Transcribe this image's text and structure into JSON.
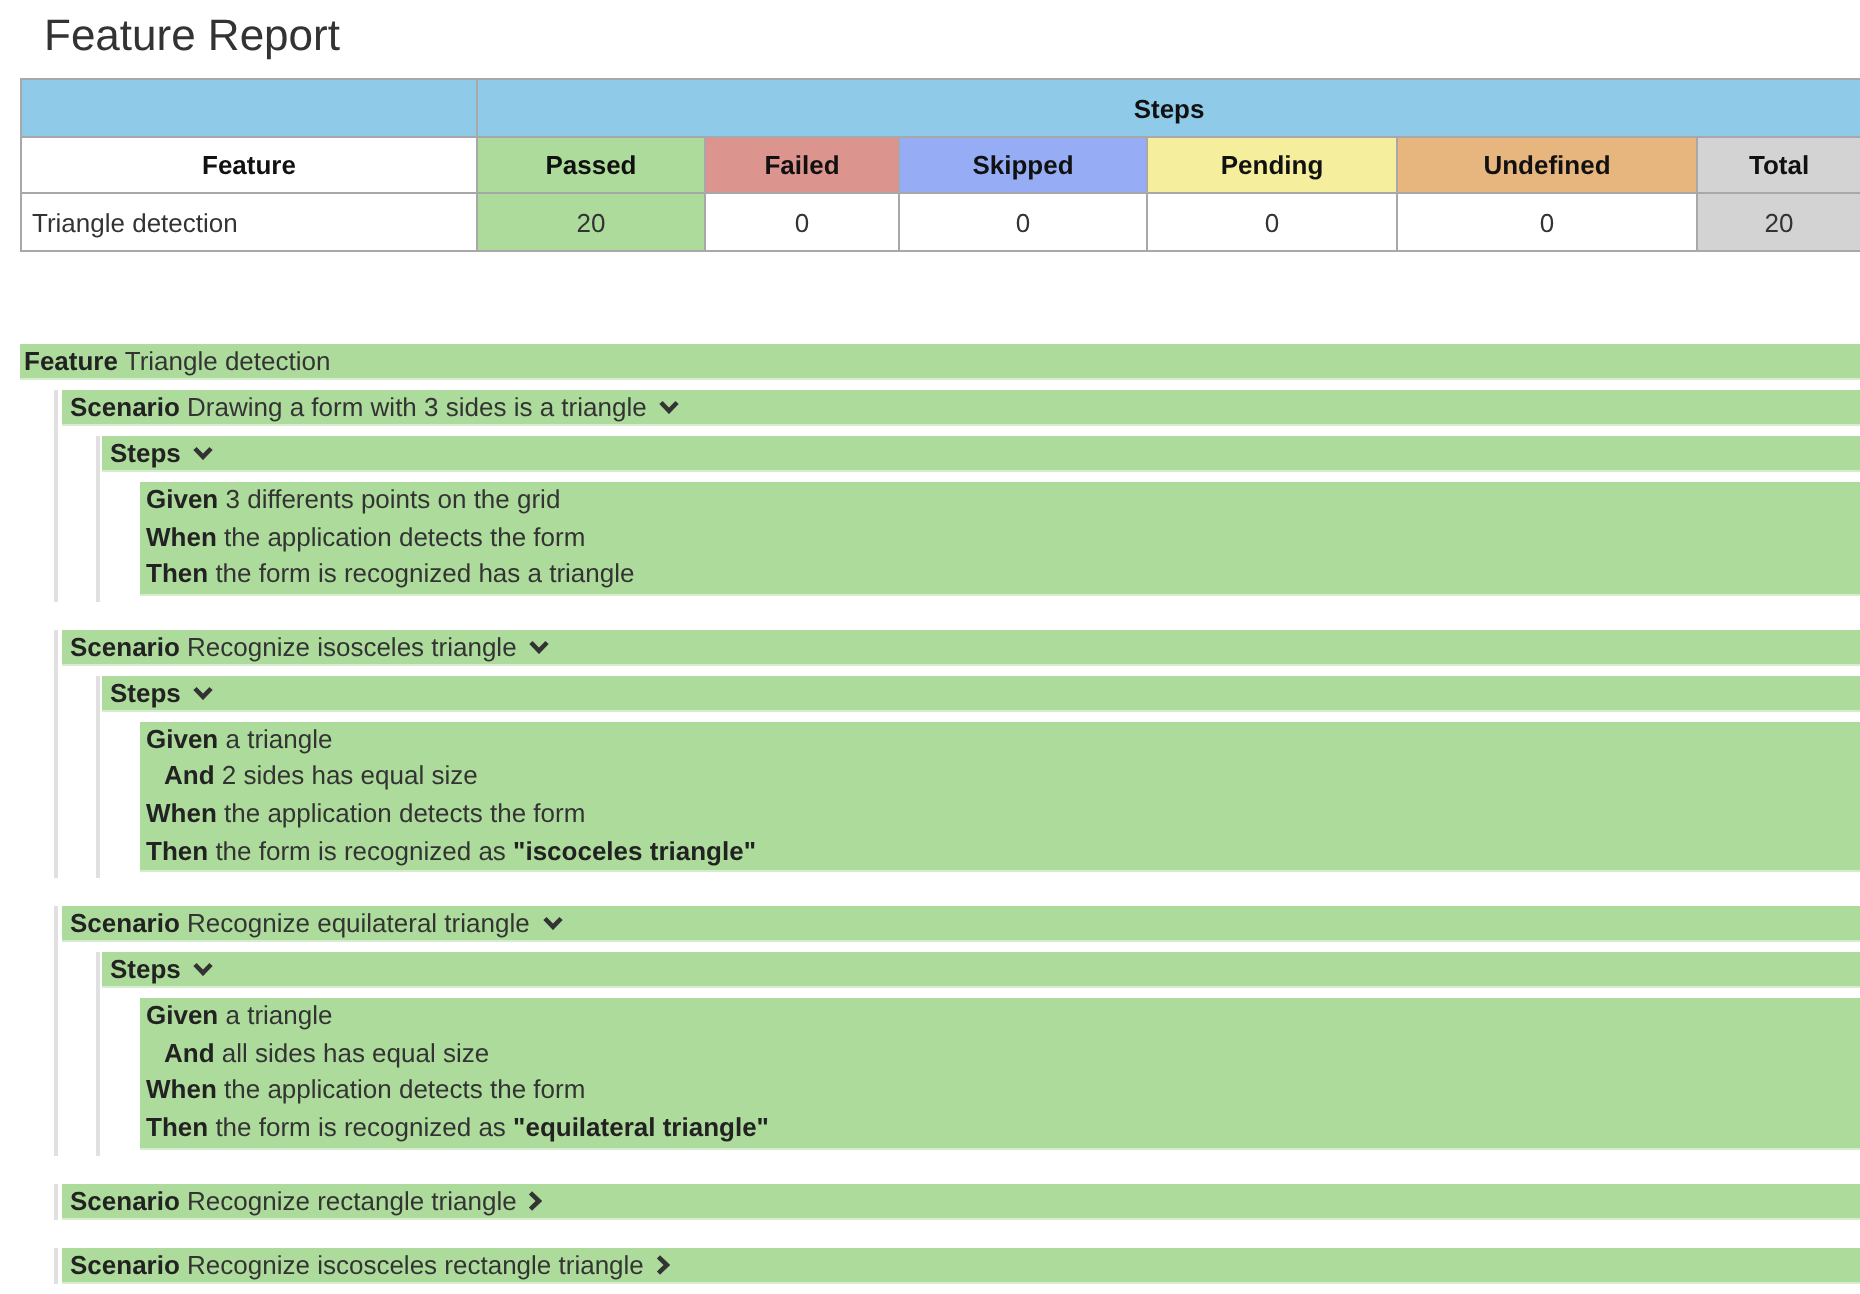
{
  "title": "Feature Report",
  "summary_table": {
    "group_header": "Steps",
    "columns": [
      {
        "label": "Feature"
      },
      {
        "label": "Passed",
        "color": "#addb9b"
      },
      {
        "label": "Failed",
        "color": "#dc948f"
      },
      {
        "label": "Skipped",
        "color": "#96adf6"
      },
      {
        "label": "Pending",
        "color": "#f5ef9d"
      },
      {
        "label": "Undefined",
        "color": "#e6b67e"
      },
      {
        "label": "Total",
        "color": "#d3d3d3"
      }
    ],
    "rows": [
      {
        "feature": "Triangle detection",
        "counts": [
          {
            "value": "20",
            "highlighted": true
          },
          {
            "value": "0",
            "highlighted": false
          },
          {
            "value": "0",
            "highlighted": false
          },
          {
            "value": "0",
            "highlighted": false
          },
          {
            "value": "0",
            "highlighted": false
          },
          {
            "value": "20",
            "highlighted": true
          }
        ]
      }
    ]
  },
  "feature": {
    "keyword": "Feature",
    "name": "Triangle detection",
    "scenarios": [
      {
        "keyword": "Scenario",
        "name": "Drawing a form with 3 sides is a triangle",
        "expanded": true,
        "steps_section": {
          "label": "Steps",
          "expanded": true,
          "steps": [
            {
              "keyword": "Given",
              "text": "3 differents points on the grid",
              "indented": false
            },
            {
              "keyword": "When",
              "text": "the application detects the form",
              "indented": false
            },
            {
              "keyword": "Then",
              "text": "the form is recognized has a triangle",
              "indented": false
            }
          ]
        }
      },
      {
        "keyword": "Scenario",
        "name": "Recognize isosceles triangle",
        "expanded": true,
        "steps_section": {
          "label": "Steps",
          "expanded": true,
          "steps": [
            {
              "keyword": "Given",
              "text": "a triangle",
              "indented": false
            },
            {
              "keyword": "And",
              "text": "2 sides has equal size",
              "indented": true
            },
            {
              "keyword": "When",
              "text": "the application detects the form",
              "indented": false
            },
            {
              "keyword": "Then",
              "text": "the form is recognized as **\"iscoceles triangle\"**",
              "indented": false
            }
          ]
        }
      },
      {
        "keyword": "Scenario",
        "name": "Recognize equilateral triangle",
        "expanded": true,
        "steps_section": {
          "label": "Steps",
          "expanded": true,
          "steps": [
            {
              "keyword": "Given",
              "text": "a triangle",
              "indented": false
            },
            {
              "keyword": "And",
              "text": "all sides has equal size",
              "indented": true
            },
            {
              "keyword": "When",
              "text": "the application detects the form",
              "indented": false
            },
            {
              "keyword": "Then",
              "text": "the form is recognized as **\"equilateral triangle\"**",
              "indented": false
            }
          ]
        }
      },
      {
        "keyword": "Scenario",
        "name": "Recognize rectangle triangle",
        "expanded": false
      },
      {
        "keyword": "Scenario",
        "name": "Recognize iscosceles rectangle triangle",
        "expanded": false
      }
    ]
  }
}
